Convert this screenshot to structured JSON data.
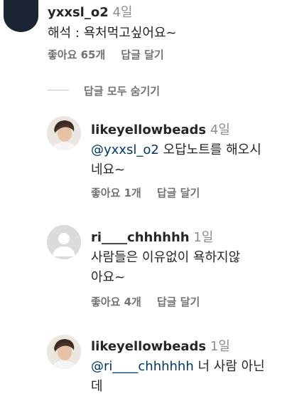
{
  "comments": [
    {
      "username": "yxxsl_o2",
      "time": "4일",
      "text_line1": "해석 : 욕처먹고싶어요~",
      "likes": "좋아요 65개",
      "reply": "답글 달기"
    }
  ],
  "hide_replies": "답글 모두 숨기기",
  "replies": [
    {
      "username": "likeyellowbeads",
      "time": "4일",
      "mention": "@yxxsl_o2",
      "text_line1": "오답노트를 해오시",
      "text_line2": "네요~",
      "likes": "좋아요 1개",
      "reply": "답글 달기"
    },
    {
      "username": "ri____chhhhhh",
      "time": "1일",
      "text_line1": "사람들은 이유없이 욕하지않",
      "text_line2": "아요~",
      "likes": "좋아요 4개",
      "reply": "답글 달기"
    },
    {
      "username": "likeyellowbeads",
      "time": "1일",
      "mention": "@ri____chhhhhh",
      "text_line1": "너 사람 아닌",
      "text_line2": "데"
    }
  ],
  "colors": {
    "text": "#262626",
    "secondary": "#737373",
    "mention": "#00376b",
    "divider": "#c7c7c7"
  }
}
